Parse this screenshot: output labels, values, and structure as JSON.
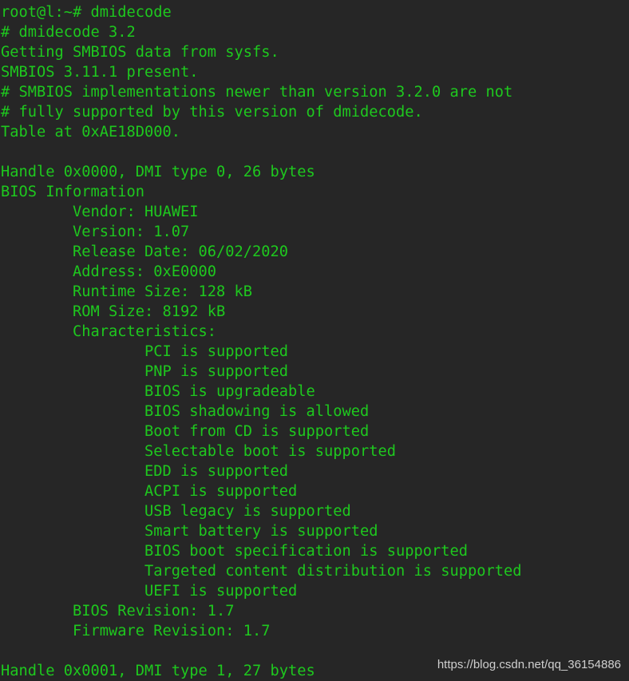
{
  "terminal": {
    "text_color": "#1ec81e",
    "background_color": "#262626",
    "lines": [
      "root@l:~# dmidecode",
      "# dmidecode 3.2",
      "Getting SMBIOS data from sysfs.",
      "SMBIOS 3.11.1 present.",
      "# SMBIOS implementations newer than version 3.2.0 are not",
      "# fully supported by this version of dmidecode.",
      "Table at 0xAE18D000.",
      "",
      "Handle 0x0000, DMI type 0, 26 bytes",
      "BIOS Information",
      "        Vendor: HUAWEI",
      "        Version: 1.07",
      "        Release Date: 06/02/2020",
      "        Address: 0xE0000",
      "        Runtime Size: 128 kB",
      "        ROM Size: 8192 kB",
      "        Characteristics:",
      "                PCI is supported",
      "                PNP is supported",
      "                BIOS is upgradeable",
      "                BIOS shadowing is allowed",
      "                Boot from CD is supported",
      "                Selectable boot is supported",
      "                EDD is supported",
      "                ACPI is supported",
      "                USB legacy is supported",
      "                Smart battery is supported",
      "                BIOS boot specification is supported",
      "                Targeted content distribution is supported",
      "                UEFI is supported",
      "        BIOS Revision: 1.7",
      "        Firmware Revision: 1.7",
      "",
      "Handle 0x0001, DMI type 1, 27 bytes"
    ]
  },
  "watermark": "https://blog.csdn.net/qq_36154886"
}
